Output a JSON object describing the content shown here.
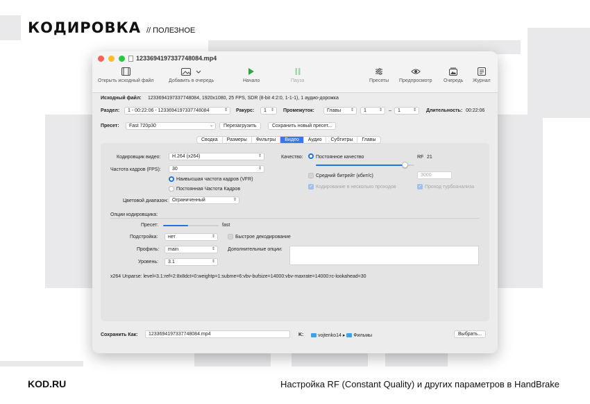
{
  "brand": {
    "logo": "КОДИРОВКА",
    "tag": "// ПОЛЕЗНОЕ"
  },
  "footer": {
    "site": "KOD.RU",
    "caption": "Настройка RF (Constant Quality) и других параметров в HandBrake"
  },
  "window": {
    "title": "1233694197337748084.mp4"
  },
  "toolbar": {
    "open_source": "Открыть исходный файл",
    "add_queue": "Добавить в очередь",
    "start": "Начало",
    "pause": "Пауза",
    "presets": "Пресеты",
    "preview": "Предпросмотр",
    "queue": "Очередь",
    "log": "Журнал"
  },
  "source": {
    "label": "Исходный файл:",
    "value": "1233694197337748084, 1920x1080, 25 FPS, SDR (8-bit 4:2:0, 1-1-1), 1 аудио-дорожка"
  },
  "title_row": {
    "title_label": "Раздел:",
    "title_value": "1 - 00:22:06 - 1233694197337748084",
    "angle_label": "Ракурс:",
    "angle_value": "1",
    "range_label": "Промежуток:",
    "range_type": "Главы",
    "range_from": "1",
    "range_dash": "–",
    "range_to": "1",
    "duration_label": "Длительность:",
    "duration_value": "00:22:06"
  },
  "preset_row": {
    "label": "Пресет:",
    "value": "Fast 720p30",
    "reload": "Перезагрузить",
    "save_new": "Сохранить новый пресет..."
  },
  "tabs": [
    "Сводка",
    "Размеры",
    "Фильтры",
    "Видео",
    "Аудио",
    "Субтитры",
    "Главы"
  ],
  "video": {
    "encoder_label": "Кодировщик видео:",
    "encoder_value": "H.264 (x264)",
    "fps_label": "Частота кадров (FPS):",
    "fps_value": "30",
    "peak_label": "Наивысшая частота кадров (VFR)",
    "constant_label": "Постоянная Частота Кадров",
    "range_label": "Цветовой диапазон:",
    "range_value": "Ограниченный",
    "quality_label": "Качество:",
    "cq_label": "Постоянное качество",
    "rf_label": "RF",
    "rf_value": "21",
    "rf_fraction": 0.9,
    "abr_label": "Средний битрейт (кбит/с)",
    "abr_value": "3000",
    "multipass_label": "Кодирование в несколько проходов",
    "turbo_label": "Проход турбоанализа",
    "options_header": "Опции кодировщика:",
    "preset_label": "Пресет:",
    "preset_value": "fast",
    "preset_fraction": 0.45,
    "tune_label": "Подстройка:",
    "tune_value": "нет",
    "fastdecode_label": "Быстрое декодирование",
    "profile_label": "Профиль:",
    "profile_value": "main",
    "extra_label": "Дополнительные опции:",
    "level_label": "Уровень:",
    "level_value": "3.1",
    "unparse": "x264 Unparse: level=3.1:ref=2:8x8dct=0:weightp=1:subme=6:vbv-bufsize=14000:vbv-maxrate=14000:rc-lookahead=30"
  },
  "save": {
    "label": "Сохранить Как:",
    "value": "1233694197337748084.mp4",
    "to_label": "K:",
    "path_user": "vojtenko14",
    "path_sep": "▸",
    "path_folder": "Фильмы",
    "choose": "Выбрать..."
  }
}
